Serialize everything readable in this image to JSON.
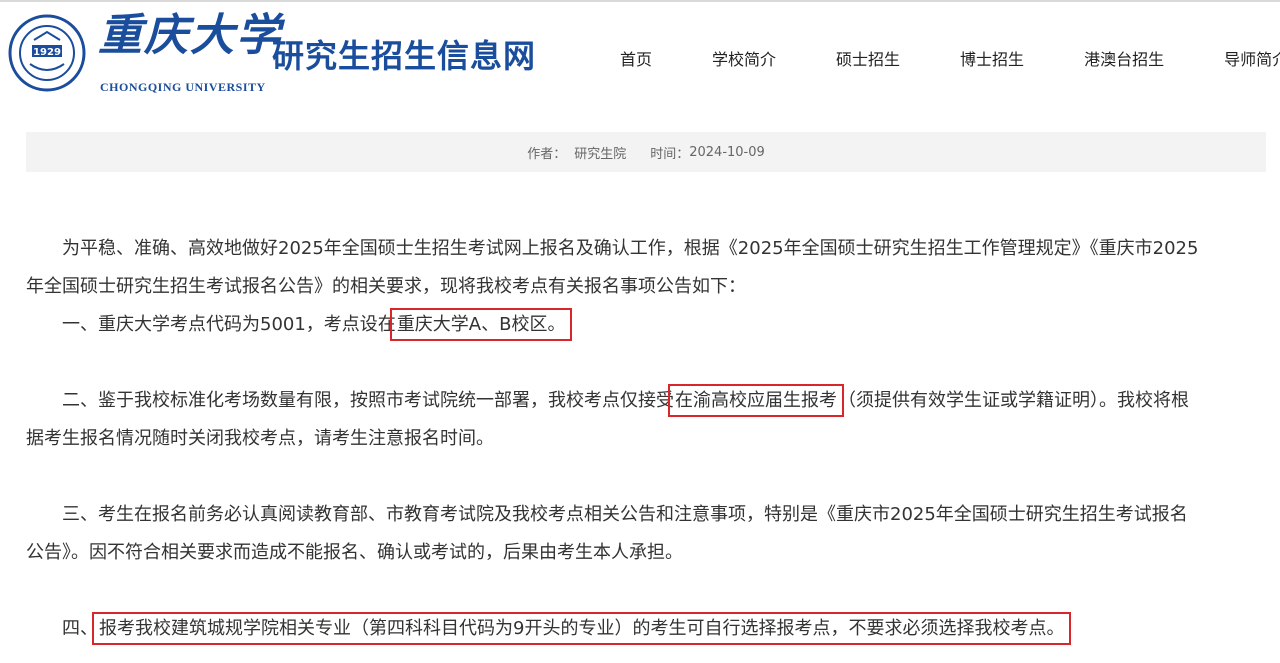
{
  "header": {
    "logo_cn": "重庆大学",
    "logo_en": "CHONGQING UNIVERSITY",
    "seal_year": "1929",
    "site_title": "研究生招生信息网",
    "nav": [
      {
        "label": "首页"
      },
      {
        "label": "学校简介"
      },
      {
        "label": "硕士招生"
      },
      {
        "label": "博士招生"
      },
      {
        "label": "港澳台招生"
      },
      {
        "label": "导师简介"
      }
    ]
  },
  "meta": {
    "author_label": "作者：",
    "author": "研究生院",
    "time_label": "时间：",
    "time": "2024-10-09"
  },
  "article": {
    "p1_line1": "为平稳、准确、高效地做好2025年全国硕士生招生考试网上报名及确认工作，根据《2025年全国硕士研究生招生工作管理规定》《重庆市2025",
    "p1_line2": "年全国硕士研究生招生考试报名公告》的相关要求，现将我校考点有关报名事项公告如下：",
    "p2_pre": "一、重庆大学考点代码为5001，考点设在",
    "p2_hl": "重庆大学A、B校区。",
    "p3_pre": "二、鉴于我校标准化考场数量有限，按照市考试院统一部署，我校考点仅接受",
    "p3_hl": "在渝高校应届生报考",
    "p3_post": "（须提供有效学生证或学籍证明）。我校将根",
    "p3_line2": "据考生报名情况随时关闭我校考点，请考生注意报名时间。",
    "p4_line1": "三、考生在报名前务必认真阅读教育部、市教育考试院及我校考点相关公告和注意事项，特别是《重庆市2025年全国硕士研究生招生考试报名",
    "p4_line2": "公告》。因不符合相关要求而造成不能报名、确认或考试的，后果由考生本人承担。",
    "p5_pre": "四、",
    "p5_hl": "报考我校建筑城规学院相关专业（第四科科目代码为9开头的专业）的考生可自行选择报考点，不要求必须选择我校考点。"
  }
}
